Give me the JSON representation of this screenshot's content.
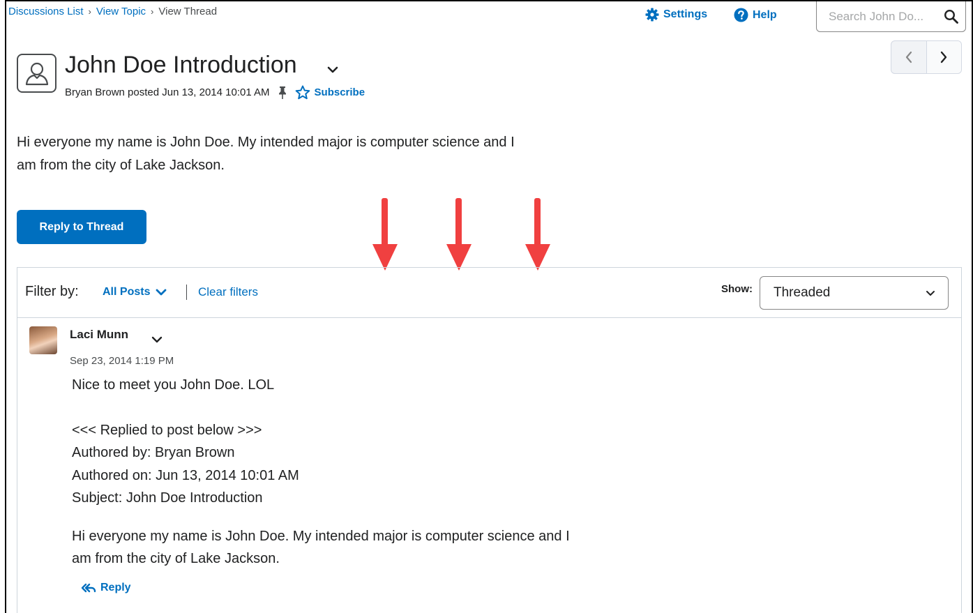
{
  "breadcrumb": {
    "items": [
      "Discussions List",
      "View Topic"
    ],
    "current": "View Thread"
  },
  "header": {
    "settings_label": "Settings",
    "help_label": "Help",
    "search_placeholder": "Search John Do..."
  },
  "thread": {
    "title": "John Doe Introduction",
    "meta": "Bryan Brown posted Jun 13, 2014 10:01 AM",
    "subscribe_label": "Subscribe",
    "body_line1": "Hi everyone my name is John Doe. My intended major is computer science and I",
    "body_line2": "am from the city of Lake Jackson.",
    "reply_button_label": "Reply to Thread"
  },
  "filter": {
    "label": "Filter by:",
    "all_posts_label": "All Posts",
    "clear_label": "Clear filters",
    "show_label": "Show:",
    "show_value": "Threaded"
  },
  "post": {
    "author": "Laci Munn",
    "date": "Sep 23, 2014 1:19 PM",
    "message": "Nice to meet you John Doe. LOL",
    "quote_header": "<<< Replied to post below >>>",
    "authored_by": "Authored by: Bryan Brown",
    "authored_on": "Authored on: Jun 13, 2014 10:01 AM",
    "subject": "Subject: John Doe Introduction",
    "quoted_line1": "Hi everyone my name is John Doe. My intended major is computer science and I",
    "quoted_line2": "am from the city of Lake Jackson.",
    "reply_label": "Reply"
  },
  "colors": {
    "link": "#006fbf",
    "primary_button": "#006fbf",
    "annotation_arrow": "#f04040"
  }
}
